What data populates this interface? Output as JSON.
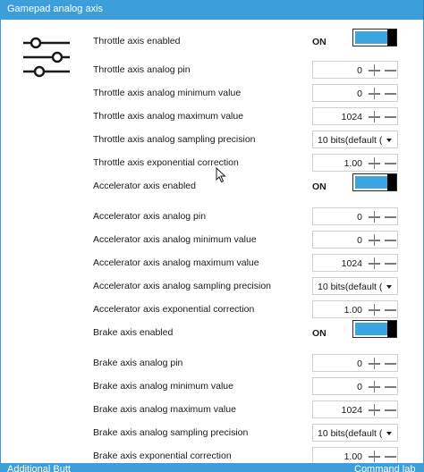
{
  "header": {
    "title": "Gamepad analog axis"
  },
  "footer": {
    "left_label": "Additional Butt",
    "right_label": "Command lab"
  },
  "rows": [
    {
      "label": "Throttle axis enabled",
      "kind": "toggle",
      "state": "ON"
    },
    {
      "label": "Throttle axis analog pin",
      "kind": "number",
      "value": "0"
    },
    {
      "label": "Throttle axis analog minimum value",
      "kind": "number",
      "value": "0"
    },
    {
      "label": "Throttle axis analog maximum value",
      "kind": "number",
      "value": "1024"
    },
    {
      "label": "Throttle axis analog sampling precision",
      "kind": "select",
      "value": "10 bits(default ("
    },
    {
      "label": "Throttle axis exponential correction",
      "kind": "number",
      "value": "1.00"
    },
    {
      "label": "Accelerator axis enabled",
      "kind": "toggle",
      "state": "ON"
    },
    {
      "label": "Accelerator axis analog pin",
      "kind": "number",
      "value": "0"
    },
    {
      "label": "Accelerator axis analog minimum value",
      "kind": "number",
      "value": "0"
    },
    {
      "label": "Accelerator axis analog maximum value",
      "kind": "number",
      "value": "1024"
    },
    {
      "label": "Accelerator axis analog sampling precision",
      "kind": "select",
      "value": "10 bits(default ("
    },
    {
      "label": "Accelerator axis exponential correction",
      "kind": "number",
      "value": "1.00"
    },
    {
      "label": "Brake axis enabled",
      "kind": "toggle",
      "state": "ON"
    },
    {
      "label": "Brake axis analog pin",
      "kind": "number",
      "value": "0"
    },
    {
      "label": "Brake axis analog minimum value",
      "kind": "number",
      "value": "0"
    },
    {
      "label": "Brake axis analog maximum value",
      "kind": "number",
      "value": "1024"
    },
    {
      "label": "Brake axis analog sampling precision",
      "kind": "select",
      "value": "10 bits(default ("
    },
    {
      "label": "Brake axis exponential correction",
      "kind": "number",
      "value": "1.00"
    }
  ],
  "icons": {
    "section_icon": "sliders-icon",
    "plus": "plus-icon",
    "minus": "minus-icon",
    "dropdown": "chevron-down-icon",
    "cursor": "mouse-pointer-icon"
  },
  "colors": {
    "accent": "#3c9fdc",
    "toggle_fill": "#3ca5e0"
  }
}
